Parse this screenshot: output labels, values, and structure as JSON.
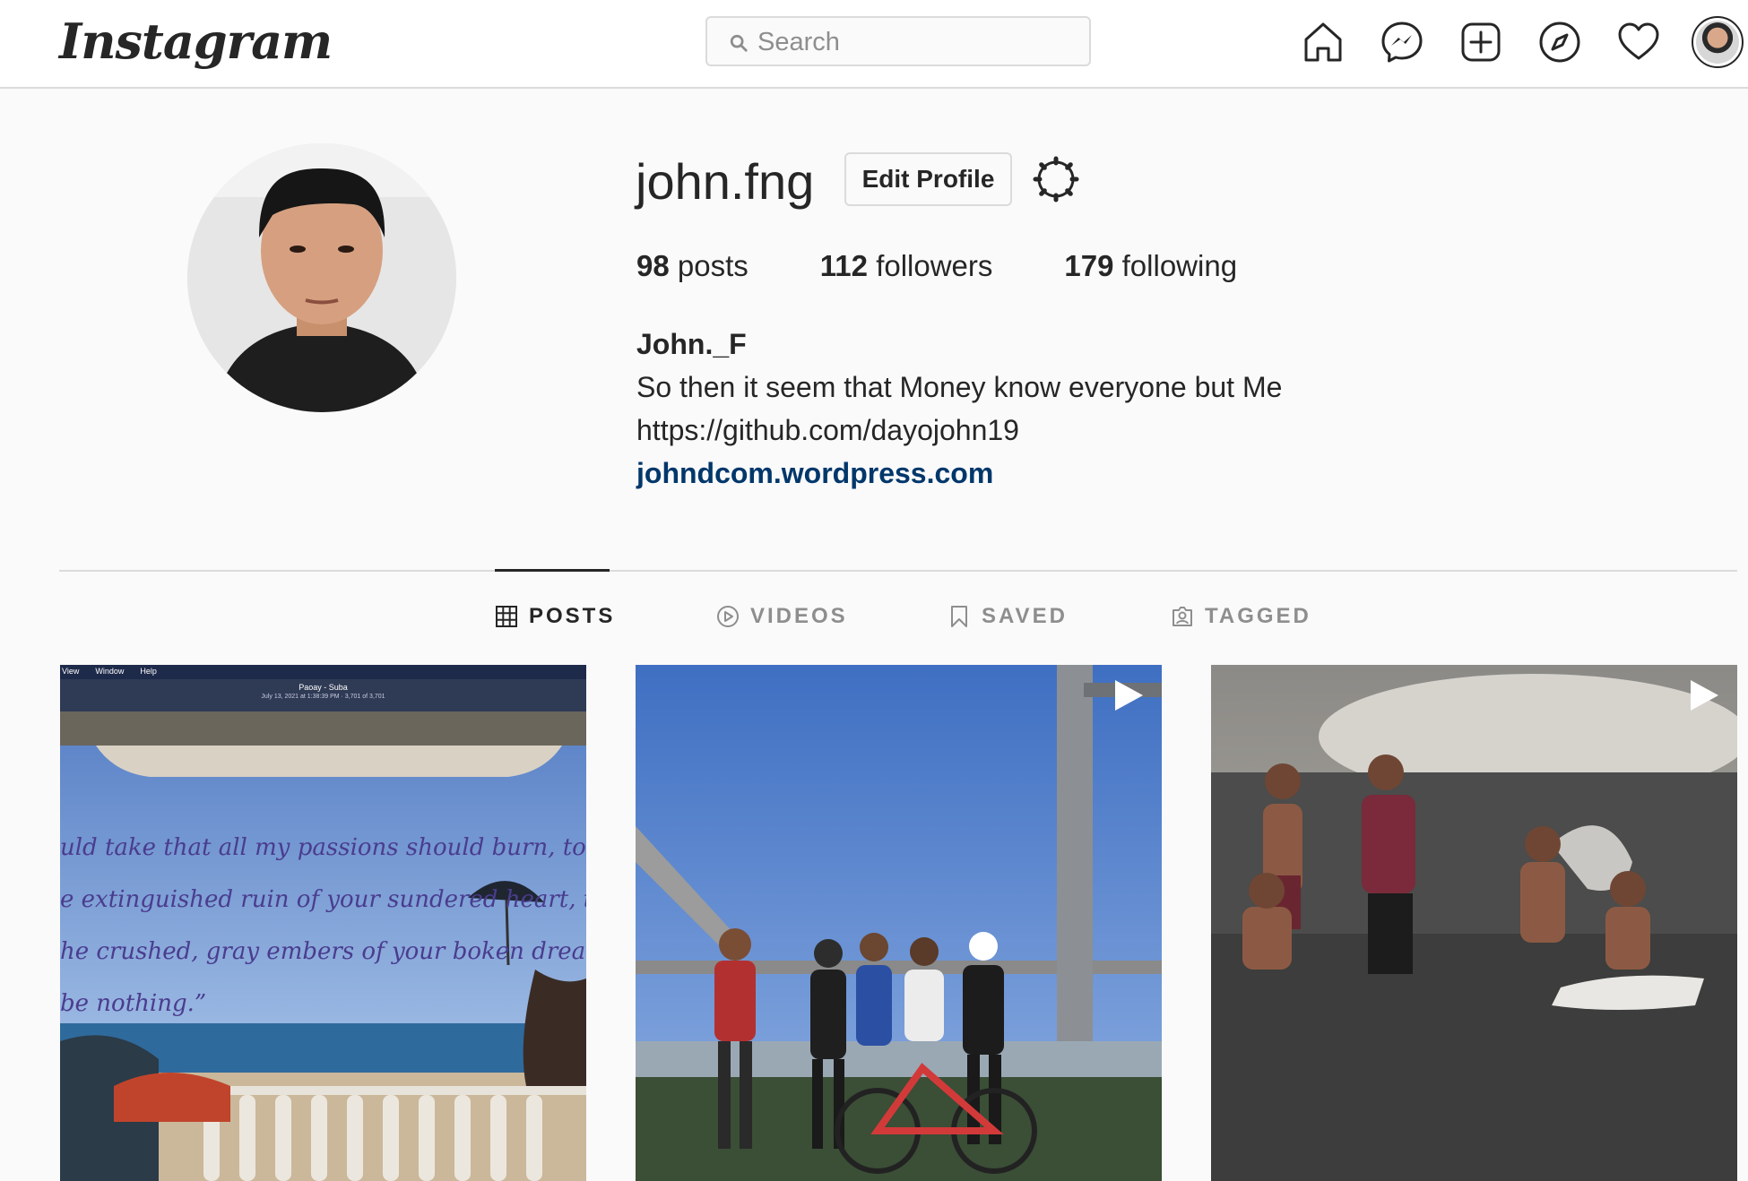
{
  "header": {
    "logo": "Instagram",
    "search_placeholder": "Search",
    "nav_icons": [
      "home-icon",
      "messenger-icon",
      "new-post-icon",
      "explore-icon",
      "activity-heart-icon",
      "profile-avatar"
    ]
  },
  "profile": {
    "username": "john.fng",
    "edit_button": "Edit Profile",
    "stats": {
      "posts_count": "98",
      "posts_label": "posts",
      "followers_count": "112",
      "followers_label": "followers",
      "following_count": "179",
      "following_label": "following"
    },
    "full_name": "John._F",
    "bio_line": "So then it seem that Money know everyone but Me",
    "bio_url": "https://github.com/dayojohn19",
    "website": "johndcom.wordpress.com"
  },
  "tabs": [
    {
      "label": "POSTS",
      "icon": "grid-icon",
      "active": true
    },
    {
      "label": "VIDEOS",
      "icon": "video-play-icon",
      "active": false
    },
    {
      "label": "SAVED",
      "icon": "bookmark-icon",
      "active": false
    },
    {
      "label": "TAGGED",
      "icon": "tagged-user-icon",
      "active": false
    }
  ],
  "posts": [
    {
      "kind": "image",
      "menu_items": [
        "View",
        "Window",
        "Help"
      ],
      "photo_title": "Paoay - Suba",
      "photo_meta": "July 13, 2021 at 1:38:39 PM · 3,701 of 3,701",
      "quote_lines": [
        "uld take that all my passions should burn, to",
        "e extinguished ruin of your sundered heart, to",
        "he crushed, gray embers of your boken dreams,",
        "be nothing.”"
      ]
    },
    {
      "kind": "video"
    },
    {
      "kind": "video"
    }
  ],
  "colors": {
    "accent_link": "#00376b",
    "border": "#dbdbdb",
    "muted_text": "#8e8e8e",
    "background": "#fafafa"
  }
}
